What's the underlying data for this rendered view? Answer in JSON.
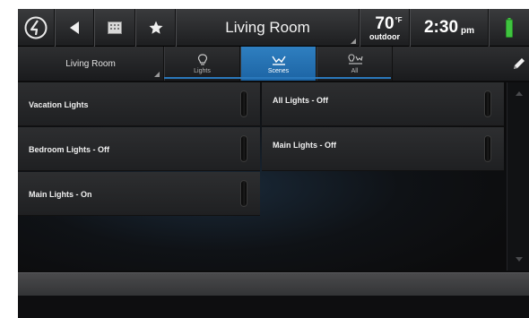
{
  "topbar": {
    "room_title": "Living Room",
    "temperature": "70",
    "temperature_unit": "°F",
    "temperature_label": "outdoor",
    "time": "2:30",
    "time_ampm": "pm"
  },
  "tabbar": {
    "room_select_label": "Living Room",
    "tabs": [
      {
        "label": "Lights",
        "icon": "bulb-icon"
      },
      {
        "label": "Scenes",
        "icon": "scenes-icon",
        "active": true
      },
      {
        "label": "All",
        "icon": "all-icon"
      }
    ]
  },
  "scenes": [
    {
      "label": "Vacation Lights"
    },
    {
      "label": "All Lights - Off"
    },
    {
      "label": "Bedroom Lights - Off"
    },
    {
      "label": "Main Lights - Off"
    },
    {
      "label": "Main Lights - On"
    }
  ],
  "colors": {
    "accent": "#2a78bb",
    "battery": "#3fc43f"
  }
}
